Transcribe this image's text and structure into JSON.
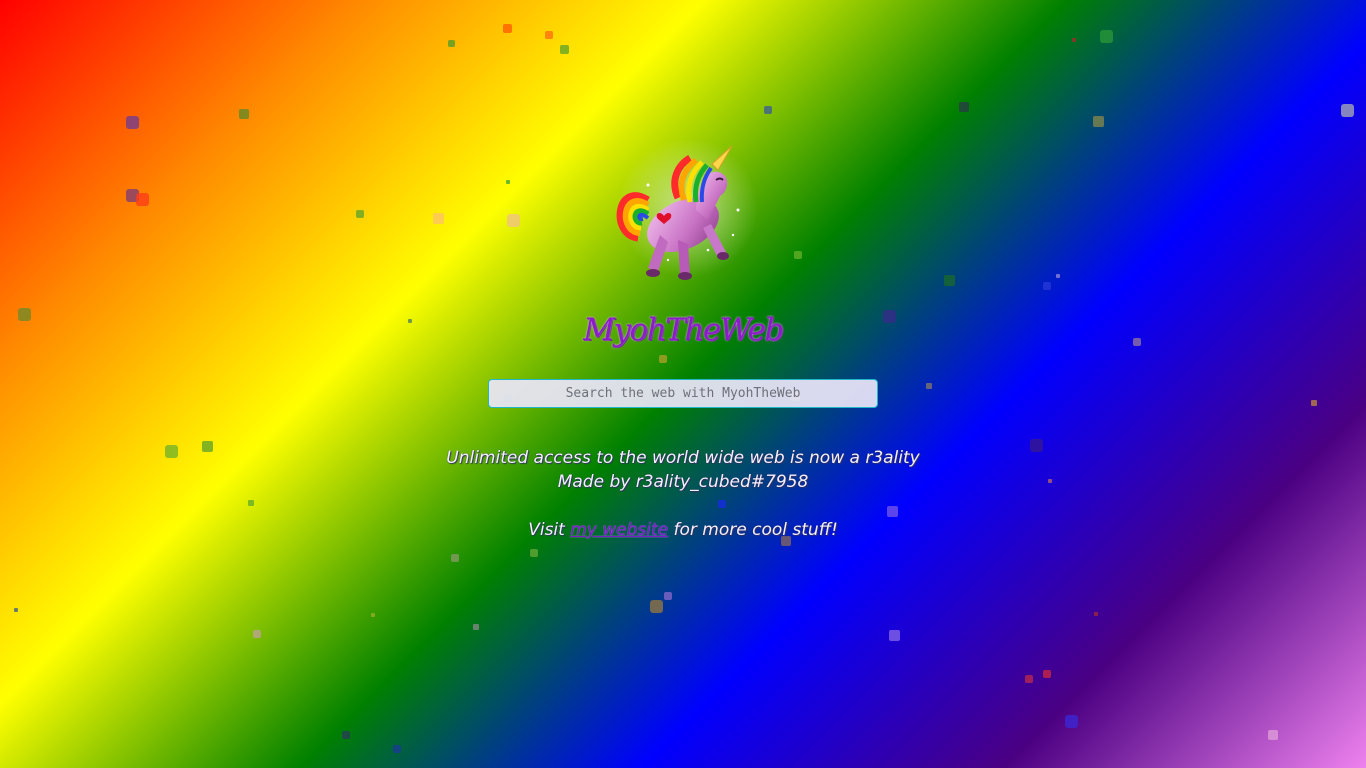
{
  "brand": {
    "logo_icon": "rainbow-unicorn-icon",
    "name": "MyohTheWeb"
  },
  "search": {
    "placeholder": "Search the web with MyohTheWeb",
    "value": ""
  },
  "tagline": {
    "line1": "Unlimited access to the world wide web is now a r3ality",
    "line2": "Made by r3ality_cubed#7958"
  },
  "visit": {
    "prefix": "Visit ",
    "link_text": "my website",
    "suffix": " for more cool stuff!"
  },
  "theme": {
    "background": "rainbow-diagonal-gradient",
    "brand_color": "#8b1cc8",
    "search_border": "#1fb8c9"
  }
}
